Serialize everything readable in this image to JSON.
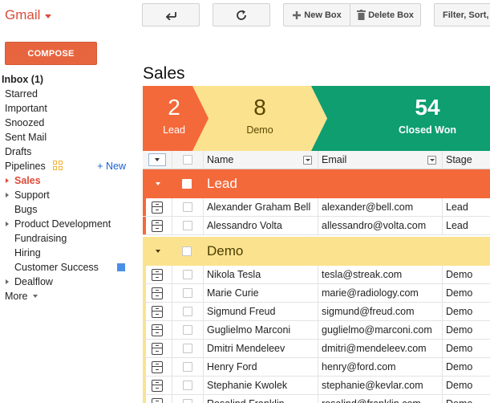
{
  "app": {
    "name": "Gmail"
  },
  "compose_label": "COMPOSE",
  "toolbar": {
    "new_box_label": "New Box",
    "delete_box_label": "Delete Box",
    "filter_label": "Filter, Sort,"
  },
  "nav": {
    "inbox": "Inbox (1)",
    "starred": "Starred",
    "important": "Important",
    "snoozed": "Snoozed",
    "sent": "Sent Mail",
    "drafts": "Drafts",
    "pipelines": "Pipelines",
    "new_link": "+ New",
    "sales": "Sales",
    "support": "Support",
    "bugs": "Bugs",
    "product_development": "Product Development",
    "fundraising": "Fundraising",
    "hiring": "Hiring",
    "customer_success": "Customer Success",
    "dealflow": "Dealflow",
    "more": "More"
  },
  "pipeline": {
    "title": "Sales",
    "stages": [
      {
        "count": "2",
        "name": "Lead",
        "color": "#f4693a"
      },
      {
        "count": "8",
        "name": "Demo",
        "color": "#fbe28f"
      },
      {
        "count": "54",
        "name": "Closed Won",
        "color": "#0e9e70"
      }
    ]
  },
  "table": {
    "columns": [
      "Name",
      "Email",
      "Stage"
    ],
    "groups": [
      {
        "label": "Lead",
        "rows": [
          {
            "name": "Alexander Graham Bell",
            "email": "alexander@bell.com",
            "stage": "Lead"
          },
          {
            "name": "Alessandro Volta",
            "email": "allessandro@volta.com",
            "stage": "Lead"
          }
        ]
      },
      {
        "label": "Demo",
        "rows": [
          {
            "name": "Nikola Tesla",
            "email": "tesla@streak.com",
            "stage": "Demo"
          },
          {
            "name": "Marie Curie",
            "email": "marie@radiology.com",
            "stage": "Demo"
          },
          {
            "name": "Sigmund Freud",
            "email": "sigmund@freud.com",
            "stage": "Demo"
          },
          {
            "name": "Guglielmo Marconi",
            "email": "guglielmo@marconi.com",
            "stage": "Demo"
          },
          {
            "name": "Dmitri Mendeleev",
            "email": "dmitri@mendeleev.com",
            "stage": "Demo"
          },
          {
            "name": "Henry Ford",
            "email": "henry@ford.com",
            "stage": "Demo"
          },
          {
            "name": "Stephanie Kwolek",
            "email": "stephanie@kevlar.com",
            "stage": "Demo"
          },
          {
            "name": "Rosalind Franklin",
            "email": "rosalind@franklin.com",
            "stage": "Demo"
          }
        ]
      }
    ]
  }
}
